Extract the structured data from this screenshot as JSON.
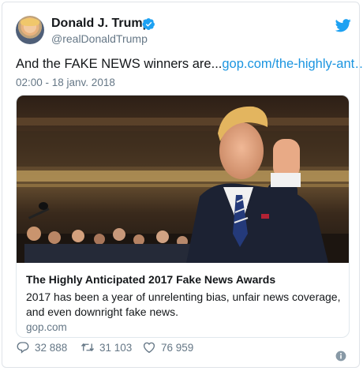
{
  "author": {
    "name": "Donald J. Trump",
    "handle": "@realDonaldTrump"
  },
  "tweet": {
    "text": "And the FAKE NEWS winners are...",
    "link_text": "gop.com/the-highly-ant…",
    "timestamp": "02:00 - 18 janv. 2018"
  },
  "card": {
    "title": "The Highly Anticipated 2017 Fake News Awards",
    "description": "2017 has been a year of unrelenting bias, unfair news coverage, and even downright fake news.",
    "domain": "gop.com"
  },
  "actions": {
    "replies": "32 888",
    "retweets": "31 103",
    "likes": "76 959"
  },
  "icons": {
    "verified": "verified-badge-icon",
    "twitter": "twitter-bird-icon",
    "reply": "reply-icon",
    "retweet": "retweet-icon",
    "like": "heart-icon",
    "info": "info-icon"
  },
  "colors": {
    "link": "#1b95e0",
    "muted": "#657786",
    "text": "#14171a",
    "verified": "#1da1f2"
  }
}
